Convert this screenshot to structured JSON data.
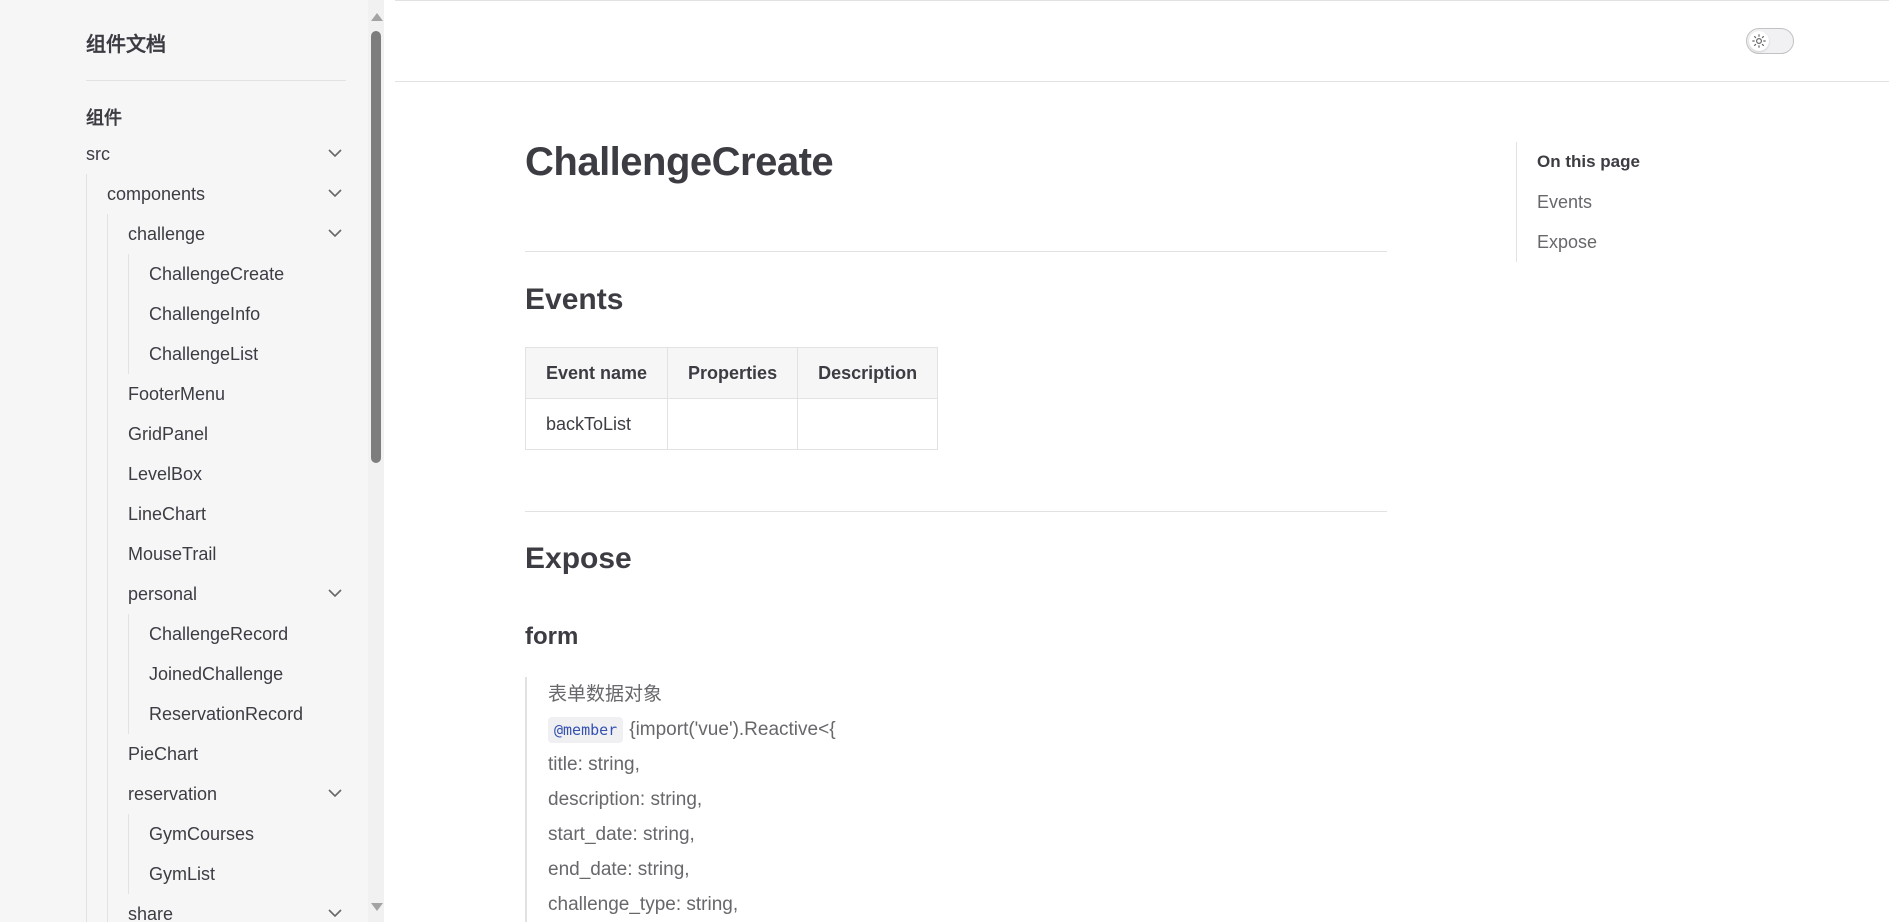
{
  "sidebar": {
    "site_title": "组件文档",
    "section_title": "组件",
    "items": [
      {
        "label": "src",
        "chevron": "chevron-down-icon"
      },
      {
        "label": "components",
        "chevron": "chevron-down-icon"
      },
      {
        "label": "challenge",
        "chevron": "chevron-down-icon"
      },
      {
        "label": "ChallengeCreate"
      },
      {
        "label": "ChallengeInfo"
      },
      {
        "label": "ChallengeList"
      },
      {
        "label": "FooterMenu"
      },
      {
        "label": "GridPanel"
      },
      {
        "label": "LevelBox"
      },
      {
        "label": "LineChart"
      },
      {
        "label": "MouseTrail"
      },
      {
        "label": "personal",
        "chevron": "chevron-down-icon"
      },
      {
        "label": "ChallengeRecord"
      },
      {
        "label": "JoinedChallenge"
      },
      {
        "label": "ReservationRecord"
      },
      {
        "label": "PieChart"
      },
      {
        "label": "reservation",
        "chevron": "chevron-down-icon"
      },
      {
        "label": "GymCourses"
      },
      {
        "label": "GymList"
      },
      {
        "label": "share",
        "chevron": "chevron-down-icon"
      }
    ]
  },
  "topbar": {
    "theme_toggle_icon": "sun-icon"
  },
  "doc": {
    "title": "ChallengeCreate",
    "events_heading": "Events",
    "events_table": {
      "headers": [
        "Event name",
        "Properties",
        "Description"
      ],
      "rows": [
        [
          "backToList",
          "",
          ""
        ]
      ]
    },
    "expose_heading": "Expose",
    "form_heading": "form",
    "form_description": "表单数据对象",
    "member_tag": "@member",
    "member_type": "{import('vue').Reactive<{",
    "fields": [
      "title: string,",
      "description: string,",
      "start_date: string,",
      "end_date: string,",
      "challenge_type: string,"
    ]
  },
  "outline": {
    "title": "On this page",
    "links": [
      "Events",
      "Expose"
    ]
  },
  "colors": {
    "sidebar_bg": "#f6f6f7",
    "text": "#3c3c43",
    "muted_text": "#67676c",
    "code_accent": "#3451b2",
    "divider": "#e2e2e3"
  }
}
